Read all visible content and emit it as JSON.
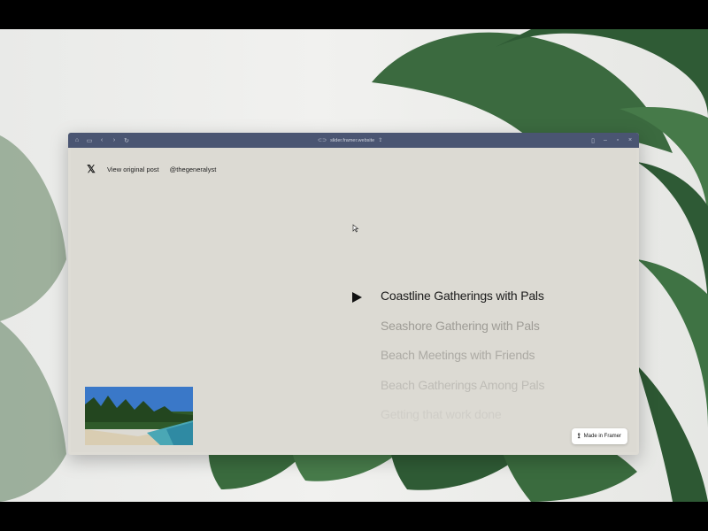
{
  "browser": {
    "url": "slider.framer.website",
    "icons": [
      "home-icon",
      "sidebar-icon",
      "back-icon",
      "forward-icon",
      "reload-icon",
      "url-lock-icon",
      "share-icon",
      "extension-icon",
      "minimize-icon",
      "maximize-icon",
      "close-icon"
    ]
  },
  "header": {
    "view_original": "View original post",
    "handle": "@thegeneralyst"
  },
  "slider": {
    "titles": [
      "Coastline Gatherings with Pals",
      "Seashore Gathering with Pals",
      "Beach Meetings with Friends",
      "Beach Gatherings Among Pals",
      "Getting that work done"
    ],
    "active_index": 0
  },
  "badge": {
    "label": "Made in Framer"
  },
  "colors": {
    "titlebar": "#4a5572",
    "page_background": "#dcdad3",
    "active_title": "#1b1b1b"
  }
}
